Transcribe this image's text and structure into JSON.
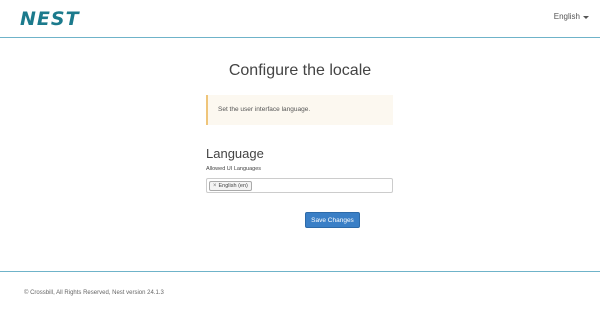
{
  "navbar": {
    "logo_text": "NEST",
    "language_menu": "English"
  },
  "page": {
    "title": "Configure the locale"
  },
  "alert": {
    "message": "Set the user interface language."
  },
  "section": {
    "title": "Language",
    "field_label": "Allowed UI Languages",
    "selected_tags": [
      {
        "label": "English (en)",
        "remove_icon": "×"
      }
    ]
  },
  "actions": {
    "save_label": "Save Changes"
  },
  "footer": {
    "text": "© Crossbill, All Rights Reserved, Nest version 24.1.3"
  },
  "colors": {
    "accent": "#6fb3c9",
    "brand": "#1b7a8c",
    "primary_button": "#3a7fc6",
    "alert_border": "#efc57a",
    "alert_bg": "#fcf8f0"
  }
}
